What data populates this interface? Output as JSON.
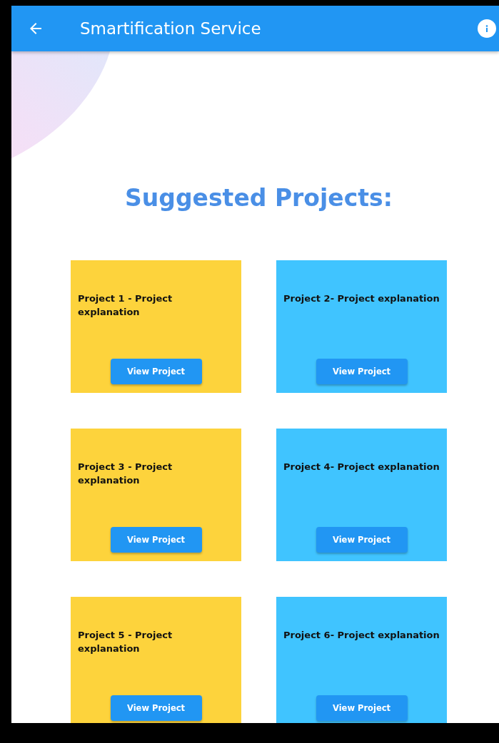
{
  "app_bar": {
    "title": "Smartification Service"
  },
  "heading": "Suggested Projects:",
  "projects": [
    {
      "text": "Project 1 - Project explanation",
      "button": "View Project",
      "color": "#fdd33c"
    },
    {
      "text": "Project 2- Project explanation",
      "button": "View Project",
      "color": "#40c4ff"
    },
    {
      "text": "Project 3 - Project explanation",
      "button": "View Project",
      "color": "#fdd33c"
    },
    {
      "text": "Project 4- Project explanation",
      "button": "View Project",
      "color": "#40c4ff"
    },
    {
      "text": "Project 5 - Project explanation",
      "button": "View Project",
      "color": "#fdd33c"
    },
    {
      "text": "Project 6- Project explanation",
      "button": "View Project",
      "color": "#40c4ff"
    }
  ]
}
